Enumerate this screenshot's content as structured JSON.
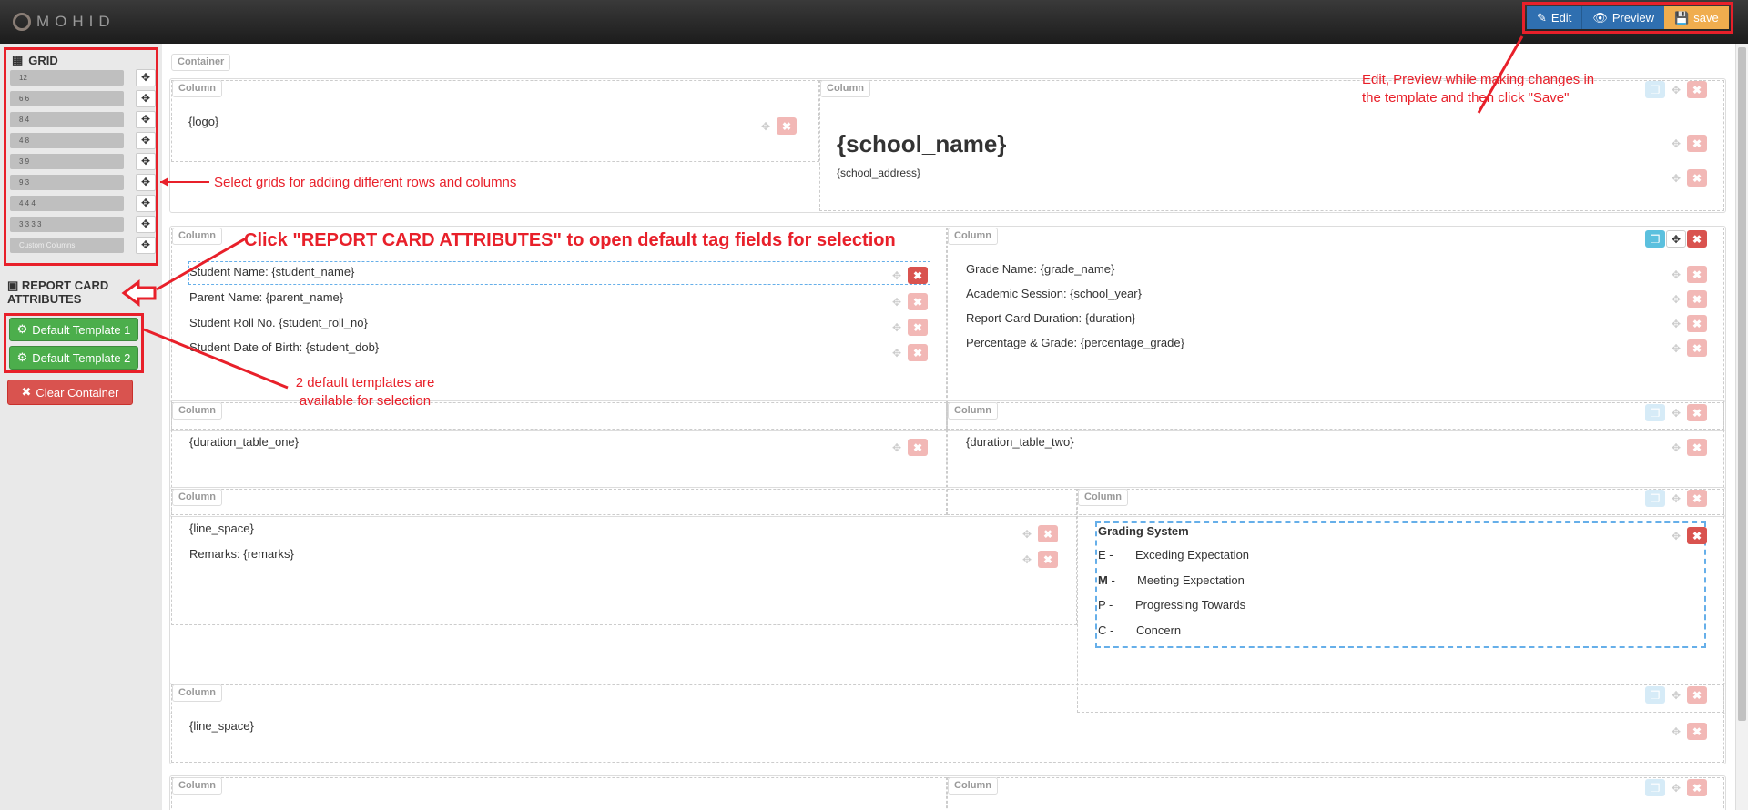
{
  "topbar": {
    "logo_text": "MOHID",
    "buttons": [
      {
        "label": "Edit",
        "icon": "edit-icon"
      },
      {
        "label": "Preview",
        "icon": "eye-icon"
      },
      {
        "label": "save",
        "icon": "floppy-icon"
      }
    ]
  },
  "sidebar": {
    "grid_heading": "GRID",
    "grids": [
      "12",
      "6 6",
      "8 4",
      "4 8",
      "3 9",
      "9 3",
      "4 4 4",
      "3 3 3 3",
      "Custom Columns"
    ],
    "report_card_attributes": "REPORT CARD ATTRIBUTES",
    "templates": [
      "Default Template 1",
      "Default Template 2"
    ],
    "clear_label": "Clear Container"
  },
  "canvas": {
    "container_label": "Container",
    "column_label": "Column",
    "header": {
      "logo": "{logo}",
      "school_name": "{school_name}",
      "school_address": "{school_address}"
    },
    "student_fields": [
      "Student Name: {student_name}",
      "Parent Name: {parent_name}",
      "Student Roll No. {student_roll_no}",
      "Student Date of Birth: {student_dob}"
    ],
    "grade_fields": [
      "Grade Name: {grade_name}",
      "Academic Session: {school_year}",
      "Report Card Duration: {duration}",
      "Percentage & Grade: {percentage_grade}"
    ],
    "duration_one": "{duration_table_one}",
    "duration_two": "{duration_table_two}",
    "line_space": "{line_space}",
    "remarks": "Remarks: {remarks}",
    "grading": {
      "title": "Grading System",
      "rows": [
        {
          "code": "E -",
          "text": "Exceding Expectation"
        },
        {
          "code": "M -",
          "text": "Meeting Expectation"
        },
        {
          "code": "P -",
          "text": "Progressing Towards"
        },
        {
          "code": "C -",
          "text": "Concern"
        }
      ]
    },
    "bottom_line_space": "{line_space}"
  },
  "annotations": {
    "top": "Edit, Preview while making changes in the template and then click \"Save\"",
    "grids": "Select grids for adding different rows and columns",
    "attributes": "Click \"REPORT CARD ATTRIBUTES\" to open default tag fields for selection",
    "templates": "2 default templates are available for selection"
  },
  "colors": {
    "annotation": "#e8202a",
    "primary": "#2f6fb0",
    "warning": "#f0ad4e",
    "success": "#4cae4c",
    "danger": "#d9534f"
  }
}
